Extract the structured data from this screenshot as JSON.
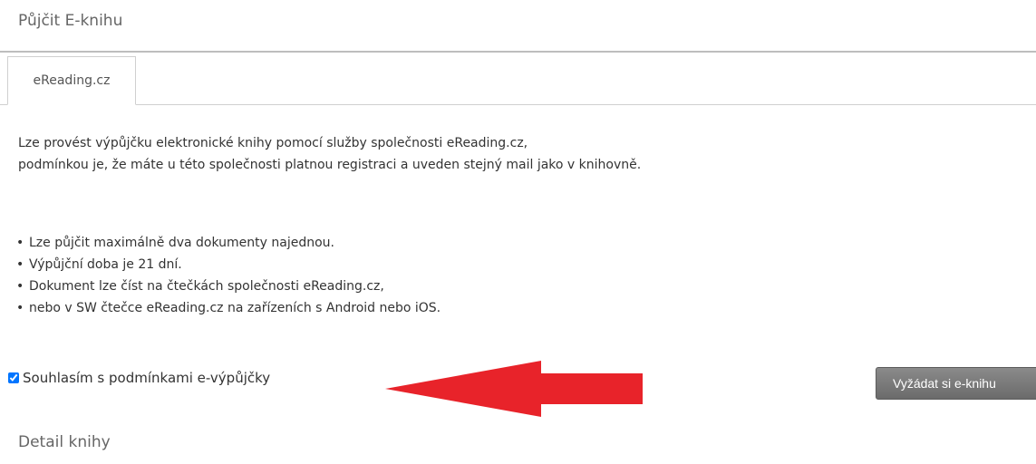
{
  "page": {
    "section_title": "Půjčit E-knihu",
    "detail_title": "Detail knihy"
  },
  "tabs": [
    {
      "label": "eReading.cz",
      "active": true
    }
  ],
  "intro": {
    "line1": "Lze provést výpůjčku elektronické knihy pomocí služby společnosti eReading.cz,",
    "line2": "podmínkou je, že máte u této společnosti platnou registraci a uveden stejný mail jako v knihovně."
  },
  "bullets": [
    "Lze půjčit maximálně dva dokumenty najednou.",
    "Výpůjční doba je 21 dní.",
    "Dokument lze číst na čtečkách společnosti eReading.cz,",
    "nebo v SW čtečce eReading.cz na zařízeních s Android nebo iOS."
  ],
  "consent": {
    "label": "Souhlasím s podmínkami e-výpůjčky",
    "checked": true
  },
  "request_button": {
    "label": "Vyžádat si e-knihu"
  },
  "annotation": {
    "arrow_color": "#e8232a",
    "arrow_icon": "left-arrow-icon"
  }
}
